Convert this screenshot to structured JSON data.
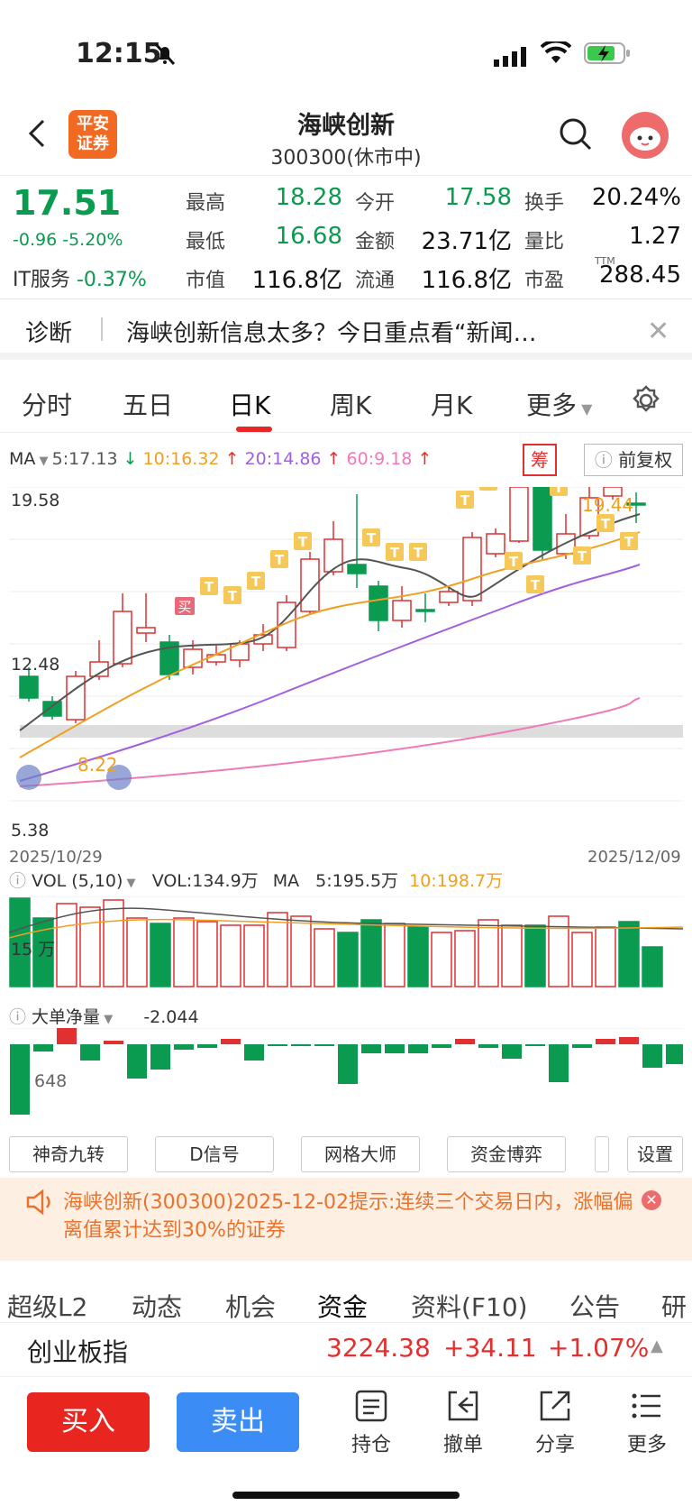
{
  "status": {
    "time": "12:15"
  },
  "header": {
    "title": "海峡创新",
    "subtitle": "300300(休市中)",
    "logo_text": "平安证券"
  },
  "quote": {
    "price": "17.51",
    "change": "-0.96",
    "change_pct": "-5.20%",
    "industry_label": "IT服务",
    "industry_change": "-0.37%",
    "cols": [
      [
        {
          "label": "最高",
          "value": "18.28",
          "color": "#0a9a50"
        },
        {
          "label": "最低",
          "value": "16.68",
          "color": "#0a9a50"
        },
        {
          "label": "市值",
          "value": "116.8亿",
          "color": "#111"
        }
      ],
      [
        {
          "label": "今开",
          "value": "17.58",
          "color": "#0a9a50"
        },
        {
          "label": "金额",
          "value": "23.71亿",
          "color": "#111"
        },
        {
          "label": "流通",
          "value": "116.8亿",
          "color": "#111"
        }
      ],
      [
        {
          "label": "换手",
          "value": "20.24%",
          "color": "#111"
        },
        {
          "label": "量比",
          "value": "1.27",
          "color": "#111"
        },
        {
          "label": "市盈",
          "value": "288.45",
          "color": "#111",
          "sup": "TTM"
        }
      ]
    ]
  },
  "diagnosis": {
    "label": "诊断",
    "text": "海峡创新信息太多？今日重点看“新闻…"
  },
  "tabs": [
    "分时",
    "五日",
    "日K",
    "周K",
    "月K",
    "更多"
  ],
  "active_tab": "日K",
  "ma": {
    "label": "MA",
    "ma5": "5:17.13",
    "ma10": "10:16.32",
    "ma20": "20:14.86",
    "ma60": "60:9.18",
    "colors": {
      "ma5": "#555555",
      "ma10": "#f0a020",
      "ma20": "#a060e0",
      "ma60": "#f07ab8"
    }
  },
  "chip_label": "筹",
  "adjust_label": "前复权",
  "chart_data": {
    "type": "candlestick",
    "y_high_label": "19.58",
    "y_mid_label": "12.48",
    "y_low_label": "5.38",
    "low_marker": "8.22",
    "high_marker": "19.44",
    "buy_marker": "买",
    "t_marker": "T",
    "date_start": "2025/10/29",
    "date_end": "2025/12/09",
    "ylim": [
      5.38,
      19.58
    ]
  },
  "volume": {
    "label": "VOL (5,10)",
    "vol": "VOL:134.9万",
    "ma_label": "MA",
    "ma5": "5:195.5万",
    "ma10": "10:198.7万",
    "axis_label": "15 万"
  },
  "bigorder": {
    "label": "大单净量",
    "value": "-2.044",
    "axis_label": "648"
  },
  "tools": [
    "神奇九转",
    "D信号",
    "网格大师",
    "资金博弈",
    "设置"
  ],
  "notice": {
    "text": "海峡创新(300300)2025-12-02提示:连续三个交易日内，涨幅偏离值累计达到30%的证券"
  },
  "bottom_tabs": [
    "超级L2",
    "动态",
    "机会",
    "资金",
    "资料(F10)",
    "公告",
    "研"
  ],
  "index": {
    "name": "创业板指",
    "value": "3224.38",
    "change": "+34.11",
    "pct": "+1.07%"
  },
  "actions": {
    "buy": "买入",
    "sell": "卖出",
    "items": [
      "持仓",
      "撤单",
      "分享",
      "更多"
    ]
  }
}
